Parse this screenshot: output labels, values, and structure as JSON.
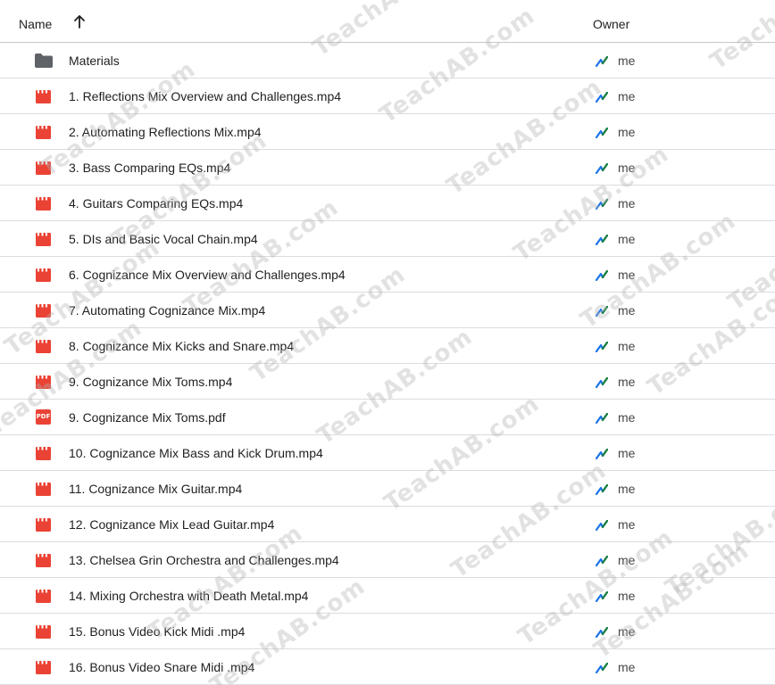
{
  "header": {
    "name_label": "Name",
    "owner_label": "Owner",
    "sort_direction": "ascending"
  },
  "colors": {
    "video_icon": "#ea4335",
    "pdf_icon": "#ea4335",
    "folder_icon": "#5f6368",
    "owner_icon_blue": "#1a73e8",
    "owner_icon_green": "#188038"
  },
  "rows": [
    {
      "name": "Materials",
      "type": "folder",
      "icon": "folder-icon",
      "owner": "me"
    },
    {
      "name": "1. Reflections Mix Overview and Challenges.mp4",
      "type": "video",
      "icon": "video-file-icon",
      "owner": "me"
    },
    {
      "name": "2. Automating Reflections Mix.mp4",
      "type": "video",
      "icon": "video-file-icon",
      "owner": "me"
    },
    {
      "name": "3. Bass Comparing EQs.mp4",
      "type": "video",
      "icon": "video-file-icon",
      "owner": "me"
    },
    {
      "name": "4. Guitars Comparing EQs.mp4",
      "type": "video",
      "icon": "video-file-icon",
      "owner": "me"
    },
    {
      "name": "5. DIs and Basic Vocal Chain.mp4",
      "type": "video",
      "icon": "video-file-icon",
      "owner": "me"
    },
    {
      "name": "6. Cognizance Mix Overview and Challenges.mp4",
      "type": "video",
      "icon": "video-file-icon",
      "owner": "me"
    },
    {
      "name": "7. Automating Cognizance Mix.mp4",
      "type": "video",
      "icon": "video-file-icon",
      "owner": "me"
    },
    {
      "name": "8. Cognizance Mix Kicks and Snare.mp4",
      "type": "video",
      "icon": "video-file-icon",
      "owner": "me"
    },
    {
      "name": "9. Cognizance Mix Toms.mp4",
      "type": "video",
      "icon": "video-file-icon",
      "owner": "me"
    },
    {
      "name": "9. Cognizance Mix Toms.pdf",
      "type": "pdf",
      "icon": "pdf-file-icon",
      "badge": "PDF",
      "owner": "me"
    },
    {
      "name": "10. Cognizance Mix Bass and Kick Drum.mp4",
      "type": "video",
      "icon": "video-file-icon",
      "owner": "me"
    },
    {
      "name": "11. Cognizance Mix Guitar.mp4",
      "type": "video",
      "icon": "video-file-icon",
      "owner": "me"
    },
    {
      "name": "12. Cognizance Mix Lead Guitar.mp4",
      "type": "video",
      "icon": "video-file-icon",
      "owner": "me"
    },
    {
      "name": "13. Chelsea Grin Orchestra and Challenges.mp4",
      "type": "video",
      "icon": "video-file-icon",
      "owner": "me"
    },
    {
      "name": "14. Mixing Orchestra with Death Metal.mp4",
      "type": "video",
      "icon": "video-file-icon",
      "owner": "me"
    },
    {
      "name": "15. Bonus Video Kick Midi .mp4",
      "type": "video",
      "icon": "video-file-icon",
      "owner": "me"
    },
    {
      "name": "16. Bonus Video Snare Midi .mp4",
      "type": "video",
      "icon": "video-file-icon",
      "owner": "me"
    }
  ],
  "watermark_text": "TeachAB.com"
}
